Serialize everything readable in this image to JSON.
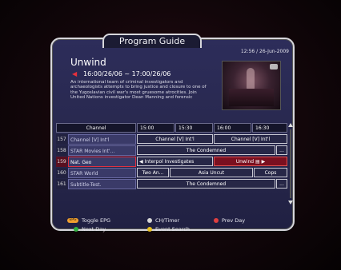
{
  "header": {
    "title": "Program Guide",
    "clock": "12:56 / 26-Jun-2009"
  },
  "info": {
    "program_title": "Unwind",
    "time_range": "16:00/26/06 ~ 17:00/26/06",
    "description": "An international team of criminal investigators and archaeologists attempts to bring justice and closure to one of the Yugoslavian civil war's most gruesome atrocities. Join United Nations investigator Dean Manning and forensic"
  },
  "grid": {
    "channel_header": "Channel",
    "times": [
      "15:00",
      "15:30",
      "16:00",
      "16:30"
    ],
    "rows": [
      {
        "number": "157",
        "channel": "Channel [V] Int'l",
        "events": [
          {
            "title": "Channel [V] Int'l"
          },
          {
            "title": "Channel [V] Int'l"
          }
        ]
      },
      {
        "number": "158",
        "channel": "STAR Movies Int'...",
        "events": [
          {
            "title": "The Condemned"
          },
          {
            "title": "..."
          }
        ]
      },
      {
        "number": "159",
        "channel": "Nat. Geo",
        "selected": true,
        "events": [
          {
            "title": "Interpol Investigates"
          },
          {
            "title": "Unwind"
          }
        ]
      },
      {
        "number": "160",
        "channel": "STAR World",
        "events": [
          {
            "title": "Two An..."
          },
          {
            "title": "Asia Uncut"
          },
          {
            "title": "Cops"
          }
        ]
      },
      {
        "number": "161",
        "channel": "Subtitle-Test.",
        "events": [
          {
            "title": "The Condemned"
          },
          {
            "title": "..."
          }
        ]
      }
    ]
  },
  "legend": [
    {
      "key_label": "EPG",
      "color": "#f0a030",
      "text": "Toggle EPG"
    },
    {
      "key_label": "",
      "color": "#d8d8d8",
      "text": "CH/Timer"
    },
    {
      "key_label": "",
      "color": "#e04040",
      "text": "Prev Day"
    },
    {
      "key_label": "",
      "color": "#30b040",
      "text": "Next Day"
    },
    {
      "key_label": "",
      "color": "#e8c020",
      "text": "Event Search"
    }
  ],
  "colors": {
    "accent_red": "#e03040",
    "panel_blue": "#2d2d5a"
  }
}
